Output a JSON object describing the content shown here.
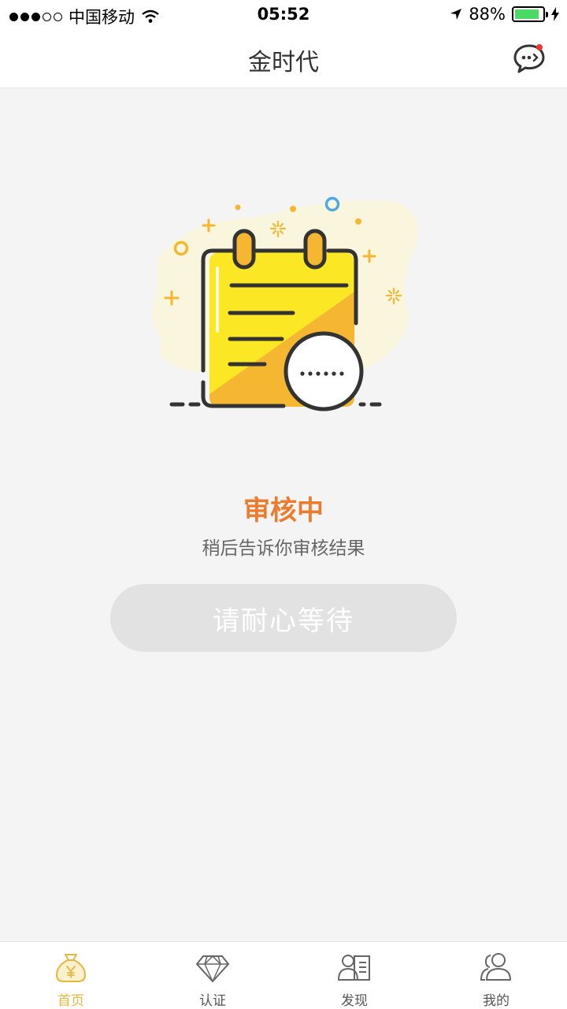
{
  "status_bar": {
    "carrier": "中国移动",
    "time": "05:52",
    "battery": "88%",
    "battery_level": 0.88
  },
  "nav": {
    "title": "金时代",
    "message_icon": "chat-bubble-icon"
  },
  "review": {
    "title": "审核中",
    "description": "稍后告诉你审核结果",
    "button_label": "请耐心等待"
  },
  "colors": {
    "accent": "#ec7b2e",
    "tab_active": "#e7b63f",
    "notepad_yellow": "#fbe723"
  },
  "tabs": [
    {
      "label": "首页",
      "icon": "money-bag-icon",
      "active": true
    },
    {
      "label": "认证",
      "icon": "diamond-icon",
      "active": false
    },
    {
      "label": "发现",
      "icon": "profile-card-icon",
      "active": false
    },
    {
      "label": "我的",
      "icon": "users-icon",
      "active": false
    }
  ]
}
